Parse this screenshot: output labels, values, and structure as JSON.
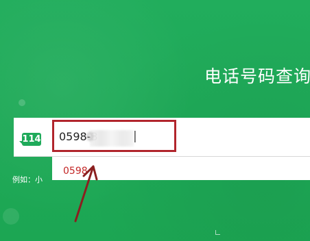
{
  "header": {
    "title": "电话号码查询"
  },
  "search": {
    "logo": "114",
    "value_visible": "0598-3",
    "value_blurred": "  0"
  },
  "suggestion": {
    "text": "0598"
  },
  "example": {
    "prefix": "例如：小"
  },
  "colors": {
    "background": "#1faa5a",
    "highlight": "#b1252c",
    "arrow": "#8b1f1f"
  }
}
